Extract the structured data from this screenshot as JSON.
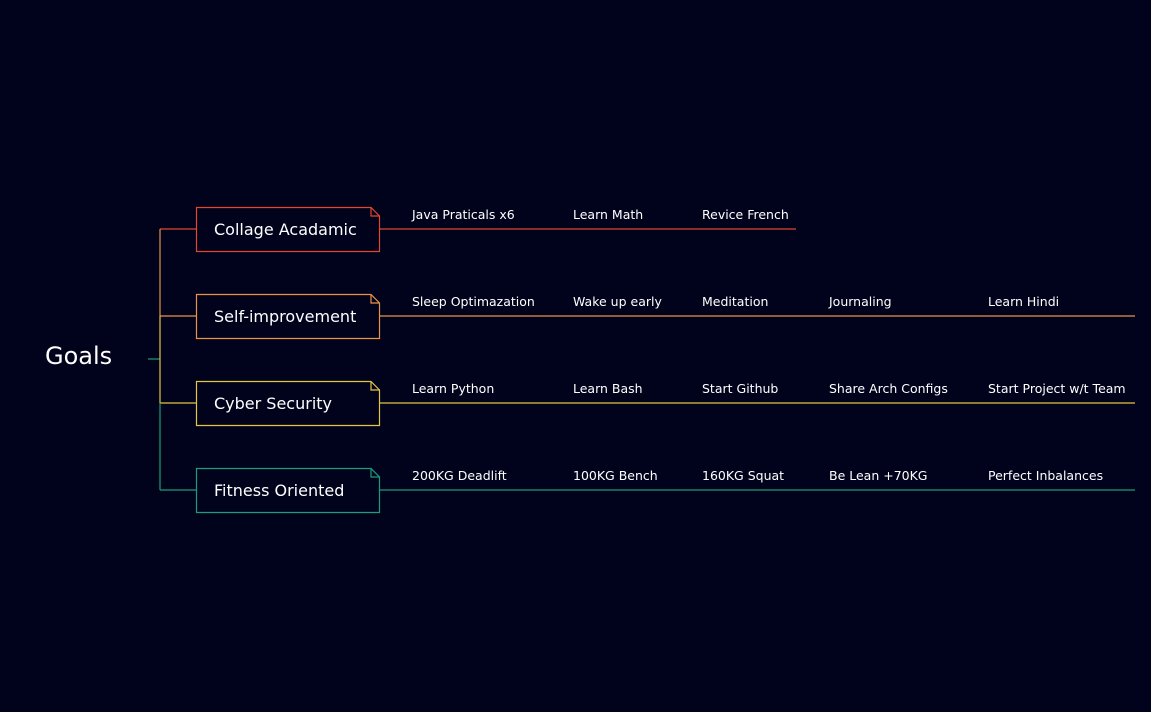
{
  "root": {
    "label": "Goals"
  },
  "colors": {
    "background": "#01021c",
    "text": "#ffffff",
    "root_connector": "#1a9e7a"
  },
  "branches": [
    {
      "label": "Collage Acadamic",
      "color": "#e0482f",
      "items": [
        "Java Praticals x6",
        "Learn Math",
        "Revice French"
      ]
    },
    {
      "label": "Self-improvement",
      "color": "#e9924a",
      "items": [
        "Sleep Optimazation",
        "Wake up early",
        "Meditation",
        "Journaling",
        "Learn Hindi"
      ]
    },
    {
      "label": "Cyber Security",
      "color": "#e2c641",
      "items": [
        "Learn Python",
        "Learn Bash",
        "Start Github",
        "Share Arch Configs",
        "Start Project w/t Team"
      ]
    },
    {
      "label": "Fitness Oriented",
      "color": "#1a9e7a",
      "items": [
        "200KG Deadlift",
        "100KG Bench",
        "160KG Squat",
        "Be Lean +70KG",
        "Perfect Inbalances"
      ]
    }
  ]
}
